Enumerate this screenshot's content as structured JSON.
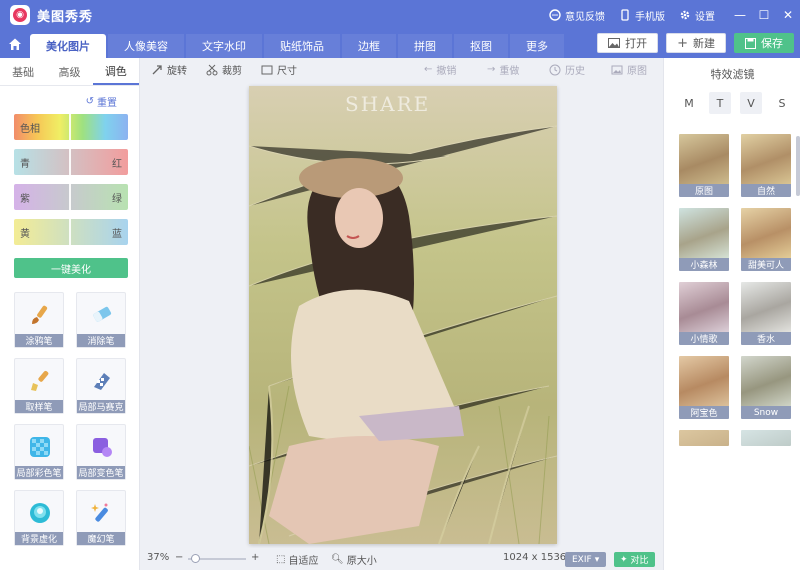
{
  "app": {
    "title": "美图秀秀"
  },
  "title_actions": {
    "feedback": "意见反馈",
    "mobile": "手机版",
    "settings": "设置"
  },
  "tabs": [
    {
      "label": "美化图片"
    },
    {
      "label": "人像美容"
    },
    {
      "label": "文字水印"
    },
    {
      "label": "贴纸饰品"
    },
    {
      "label": "边框"
    },
    {
      "label": "拼图"
    },
    {
      "label": "抠图"
    },
    {
      "label": "更多"
    }
  ],
  "actions": {
    "open": "打开",
    "new": "新建",
    "save": "保存"
  },
  "left_panel": {
    "tabs": [
      "基础",
      "高级",
      "调色"
    ],
    "reset": "重置",
    "sliders": [
      {
        "left": "色相",
        "right": ""
      },
      {
        "left": "青",
        "right": "红"
      },
      {
        "left": "紫",
        "right": "绿"
      },
      {
        "left": "黄",
        "right": "蓝"
      }
    ],
    "auto_beautify": "一键美化",
    "tools": [
      {
        "label": "涂鸦笔",
        "icon": "brush-icon"
      },
      {
        "label": "消除笔",
        "icon": "eraser-icon"
      },
      {
        "label": "取样笔",
        "icon": "sampler-brush-icon"
      },
      {
        "label": "局部马赛克",
        "icon": "mosaic-icon"
      },
      {
        "label": "局部彩色笔",
        "icon": "color-brush-icon"
      },
      {
        "label": "局部变色笔",
        "icon": "recolor-brush-icon"
      },
      {
        "label": "背景虚化",
        "icon": "blur-icon"
      },
      {
        "label": "魔幻笔",
        "icon": "magic-pen-icon"
      }
    ]
  },
  "toolbar": {
    "rotate": "旋转",
    "crop": "裁剪",
    "size": "尺寸",
    "undo": "撤销",
    "redo": "重做",
    "history": "历史",
    "original": "原图"
  },
  "canvas": {
    "watermark": "SHARE"
  },
  "status": {
    "zoom": "37%",
    "fit": "自适应",
    "actual": "原大小",
    "dimensions": "1024 x 1536",
    "exif": "EXIF",
    "compare": "对比"
  },
  "right_panel": {
    "title": "特效滤镜",
    "filter_tabs": [
      "M",
      "T",
      "V",
      "S"
    ],
    "filters": [
      {
        "label": "原图"
      },
      {
        "label": "自然"
      },
      {
        "label": "小森林"
      },
      {
        "label": "甜美可人"
      },
      {
        "label": "小情歌"
      },
      {
        "label": "香水"
      },
      {
        "label": "阿宝色"
      },
      {
        "label": "Snow"
      }
    ]
  },
  "colors": {
    "brand": "#5b75d6",
    "accent_green": "#4fc28a",
    "label_gray": "#8f9bb8"
  }
}
